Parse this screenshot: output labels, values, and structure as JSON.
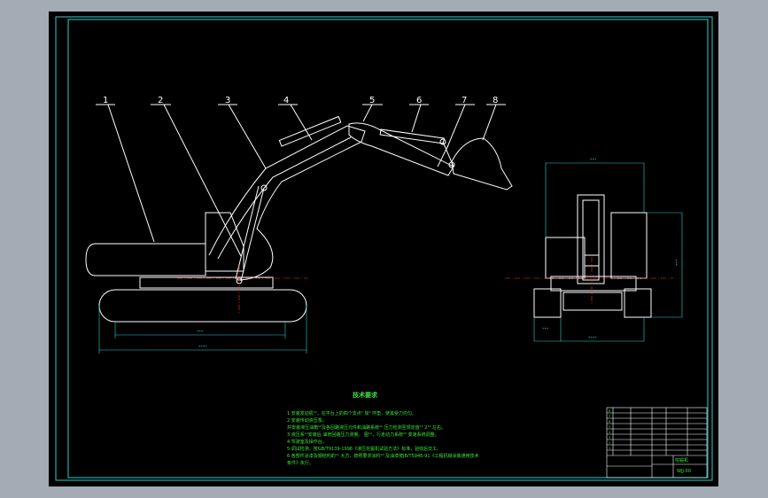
{
  "part_labels": [
    "1",
    "2",
    "3",
    "4",
    "5",
    "6",
    "7",
    "8"
  ],
  "dimensions": {
    "side_track_inner": "***",
    "side_track_outer": "****",
    "front_top": "***",
    "front_right": "***",
    "front_bottom_left": "***",
    "front_bottom_right": "****"
  },
  "tech_title": "技术要求",
  "tech_notes": [
    "1 安装发动机¹²，在平台上的四个支点¹ 加²  环垫，使其受力均匀。",
    "2 安装传动液压泵。",
    "  并安装液压油箱¹²及各回路液压元件和油路系统¹²  压力检测至规定值¹¹ 2¹⁰ 左右。",
    "3 液压系¹²安装后 油管回路压力测量。  图¹²，行走动力系统¹²  变速系统调整。",
    "4 驾驶室及操作台。",
    "5 调试检测，按GB/T9139-1996《液压挖掘机试验方法》标准，验收后交工。",
    "6 各部件涂漆及钢结构的¹²  大方，按照要求涂料¹²  及油漆按JB/T5946-91《工程机械涂装通用技术",
    "  条件》执行。"
  ],
  "title_block": {
    "row_items": [
      "8",
      "7",
      "6",
      "5",
      "4",
      "3",
      "2",
      "1"
    ],
    "drawing_name": "挖掘机",
    "drawing_no": "WJJ-00"
  },
  "colors": {
    "sheet": "#000000",
    "frame": "#2bd1d1",
    "drawing": "#ffffff",
    "centerline": "#ff3030",
    "dimension": "#2bd1d1",
    "notes": "#38e838",
    "background": "#a3abb5"
  }
}
